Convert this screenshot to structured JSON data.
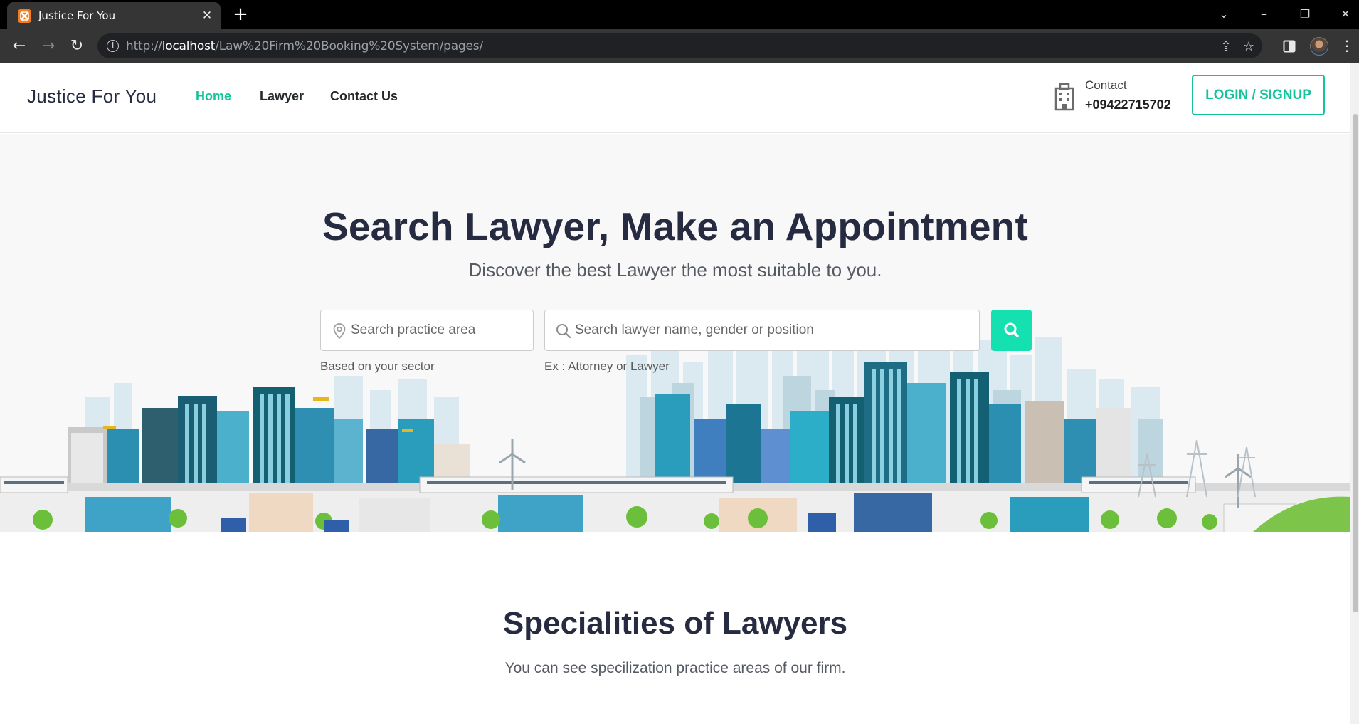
{
  "browser": {
    "tab_title": "Justice For You",
    "url_prefix": "http://",
    "url_host": "localhost",
    "url_path": "/Law%20Firm%20Booking%20System/pages/"
  },
  "header": {
    "brand": "Justice For You",
    "nav": [
      {
        "label": "Home",
        "active": true
      },
      {
        "label": "Lawyer",
        "active": false
      },
      {
        "label": "Contact Us",
        "active": false
      }
    ],
    "contact_label": "Contact",
    "contact_phone": "+09422715702",
    "login_label": "LOGIN / SIGNUP"
  },
  "hero": {
    "title": "Search Lawyer, Make an Appointment",
    "subtitle": "Discover the best Lawyer the most suitable to you.",
    "practice_placeholder": "Search practice area",
    "practice_hint": "Based on your sector",
    "lawyer_placeholder": "Search lawyer name, gender or position",
    "lawyer_hint": "Ex : Attorney or Lawyer"
  },
  "specialities": {
    "title": "Specialities of Lawyers",
    "subtitle": "You can see specilization practice areas of our firm."
  },
  "colors": {
    "accent": "#15c39a",
    "search_button": "#15e0b0",
    "heading": "#272b41"
  }
}
